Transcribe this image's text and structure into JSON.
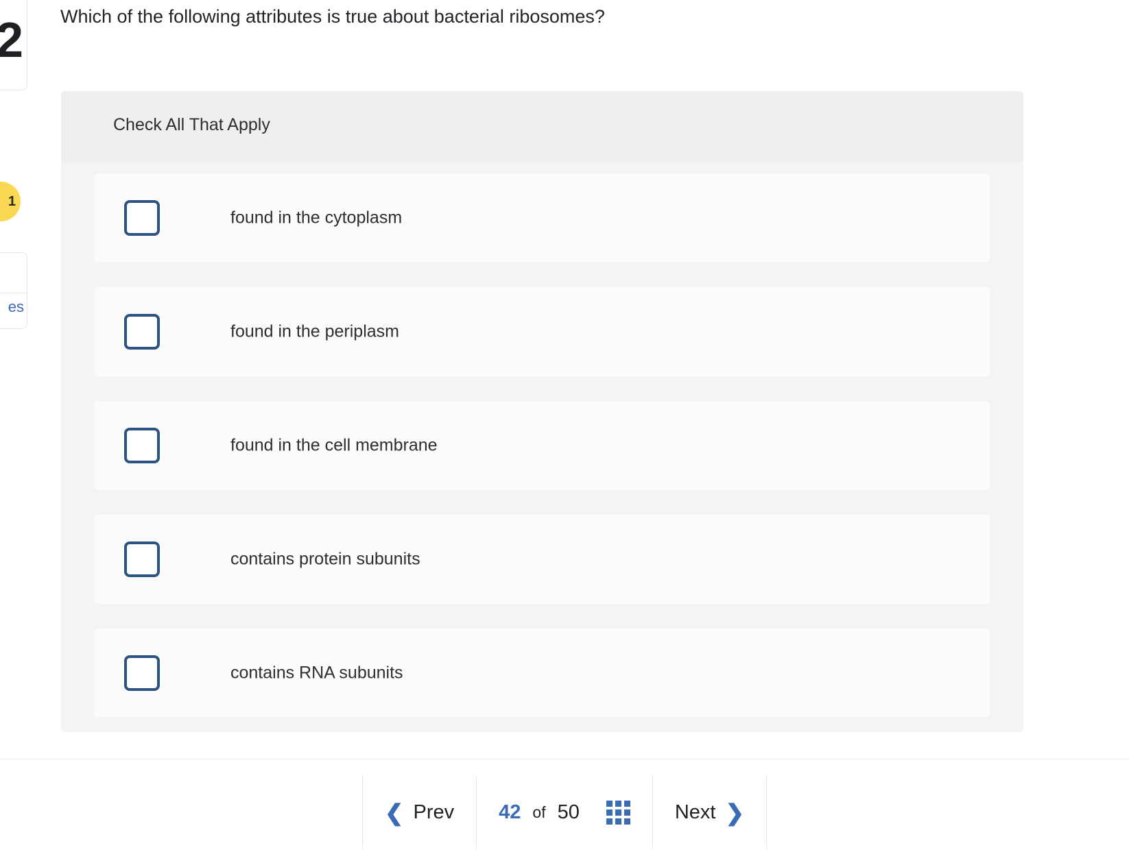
{
  "left_rail": {
    "question_number": "2",
    "flag_badge_label": "1",
    "tools_link_label": "es"
  },
  "question": {
    "prompt": "Which of the following attributes is true about bacterial ribosomes?"
  },
  "answer_panel": {
    "instruction": "Check All That Apply",
    "options": [
      {
        "label": "found in the cytoplasm",
        "checked": false
      },
      {
        "label": "found in the periplasm",
        "checked": false
      },
      {
        "label": "found in the cell membrane",
        "checked": false
      },
      {
        "label": "contains protein subunits",
        "checked": false
      },
      {
        "label": "contains RNA subunits",
        "checked": false
      }
    ]
  },
  "bottom_nav": {
    "prev_label": "Prev",
    "prev_icon": "chevron-left-icon",
    "next_label": "Next",
    "next_icon": "chevron-right-icon",
    "current_question": "42",
    "of_label": "of",
    "total_questions": "50",
    "grid_icon": "grid-view-icon"
  },
  "colors": {
    "accent_blue": "#3b6bb5",
    "checkbox_border": "#2d5382",
    "flag_yellow": "#fad854",
    "panel_bg": "#f4f4f5",
    "panel_header_bg": "#efeff0",
    "option_bg": "#fbfbfb",
    "text_primary": "#2c2e32"
  }
}
